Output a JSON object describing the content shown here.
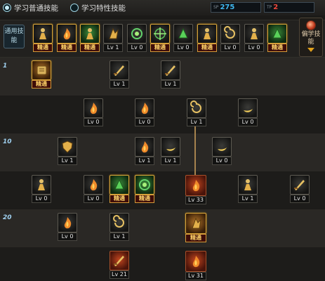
{
  "tabs": [
    {
      "label": "学习普通技能",
      "active": true
    },
    {
      "label": "学习特性技能",
      "active": false
    }
  ],
  "sp": [
    {
      "label": "SP",
      "value": "275",
      "color": "#3fb7f0"
    },
    {
      "label": "TP",
      "value": "2",
      "color": "#f0473a"
    }
  ],
  "general_label": "通用技能",
  "side_button": "偏学技能",
  "level_marks": [
    "1",
    "10",
    "20"
  ],
  "general_skills": [
    {
      "icon": "dodge-icon",
      "level": "精通",
      "mastered": true
    },
    {
      "icon": "fire-stance-icon",
      "level": "精通",
      "mastered": true
    },
    {
      "icon": "sprint-icon",
      "level": "精通",
      "mastered": true
    },
    {
      "icon": "wing-crest-icon",
      "level": "Lv 1",
      "mastered": false
    },
    {
      "icon": "target-ring-icon",
      "level": "Lv 0",
      "mastered": false
    },
    {
      "icon": "crosshair-icon",
      "level": "精通",
      "mastered": true
    },
    {
      "icon": "green-creature-icon",
      "level": "Lv 0",
      "mastered": false
    },
    {
      "icon": "guard-pose-icon",
      "level": "精通",
      "mastered": true
    },
    {
      "icon": "spiral-icon",
      "level": "Lv 0",
      "mastered": false
    },
    {
      "icon": "golden-figure-icon",
      "level": "Lv 0",
      "mastered": false
    },
    {
      "icon": "green-leap-icon",
      "level": "精通",
      "mastered": true
    }
  ],
  "tree_skills": [
    {
      "icon": "scroll-icon",
      "level": "精通",
      "mastered": true
    },
    {
      "icon": "dagger-icon",
      "level": "Lv 1",
      "mastered": false
    },
    {
      "icon": "sword-icon",
      "level": "Lv 1",
      "mastered": false
    },
    {
      "icon": "kick-icon",
      "level": "Lv 0",
      "mastered": false
    },
    {
      "icon": "fireball-icon",
      "level": "Lv 0",
      "mastered": false
    },
    {
      "icon": "dash-icon",
      "level": "Lv 1",
      "mastered": false
    },
    {
      "icon": "crescent-icon",
      "level": "Lv 0",
      "mastered": false
    },
    {
      "icon": "shield-icon",
      "level": "Lv 1",
      "mastered": false
    },
    {
      "icon": "flip-icon",
      "level": "Lv 1",
      "mastered": false
    },
    {
      "icon": "slash-icon",
      "level": "Lv 1",
      "mastered": false
    },
    {
      "icon": "wave-icon",
      "level": "Lv 0",
      "mastered": false
    },
    {
      "icon": "uppercut-icon",
      "level": "Lv 0",
      "mastered": false
    },
    {
      "icon": "claw-icon",
      "level": "Lv 0",
      "mastered": false
    },
    {
      "icon": "green-blade-icon",
      "level": "精通",
      "mastered": true
    },
    {
      "icon": "green-orb-icon",
      "level": "精通",
      "mastered": true
    },
    {
      "icon": "flame-burst-icon",
      "level": "Lv 33",
      "mastered": false
    },
    {
      "icon": "spin-kick-icon",
      "level": "Lv 1",
      "mastered": false
    },
    {
      "icon": "feather-icon",
      "level": "Lv 0",
      "mastered": false
    },
    {
      "icon": "fire-pit-icon",
      "level": "Lv 0",
      "mastered": false
    },
    {
      "icon": "whirl-icon",
      "level": "Lv 1",
      "mastered": false
    },
    {
      "icon": "multi-strike-icon",
      "level": "精通",
      "mastered": true
    },
    {
      "icon": "arrow-rain-icon",
      "level": "Lv 21",
      "mastered": false
    },
    {
      "icon": "pillar-icon",
      "level": "Lv 31",
      "mastered": false
    }
  ]
}
